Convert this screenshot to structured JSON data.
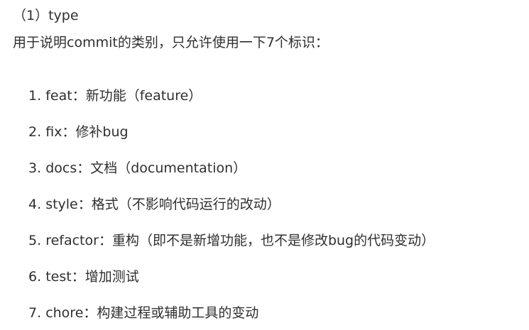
{
  "section": {
    "heading": "（1）type",
    "intro": "用于说明commit的类别，只允许使用一下7个标识："
  },
  "types": [
    {
      "number": "1.",
      "name": "feat",
      "separator": "：",
      "description": "新功能（feature）"
    },
    {
      "number": "2.",
      "name": "fix",
      "separator": "：",
      "description": "修补bug"
    },
    {
      "number": "3.",
      "name": "docs",
      "separator": "：",
      "description": "文档（documentation）"
    },
    {
      "number": "4.",
      "name": "style",
      "separator": "：",
      "description": "格式（不影响代码运行的改动）"
    },
    {
      "number": "5.",
      "name": "refactor",
      "separator": "：",
      "description": "重构（即不是新增功能，也不是修改bug的代码变动）"
    },
    {
      "number": "6.",
      "name": "test",
      "separator": "：",
      "description": "增加测试"
    },
    {
      "number": "7.",
      "name": "chore",
      "separator": "：",
      "description": "构建过程或辅助工具的变动"
    }
  ]
}
